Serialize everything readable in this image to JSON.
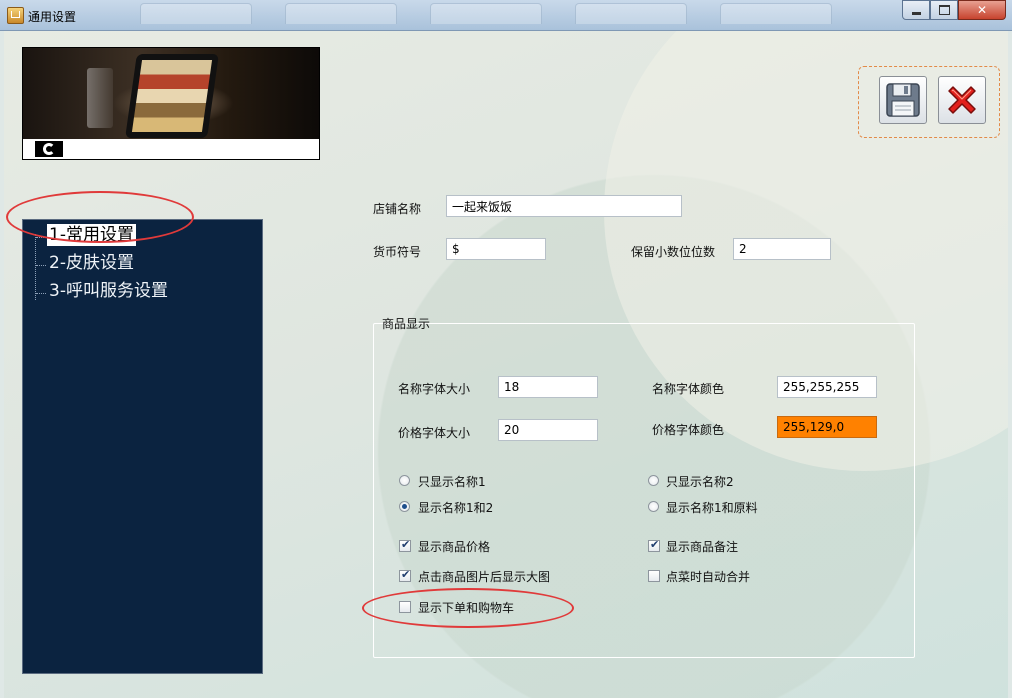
{
  "window": {
    "title": "通用设置",
    "close_glyph": "✕"
  },
  "nav": {
    "items": [
      {
        "label": "1-常用设置",
        "selected": true
      },
      {
        "label": "2-皮肤设置",
        "selected": false
      },
      {
        "label": "3-呼叫服务设置",
        "selected": false
      }
    ]
  },
  "toolbar": {
    "save_icon": "floppy-disk-icon",
    "close_icon": "red-x-icon"
  },
  "form": {
    "store_name_label": "店铺名称",
    "store_name_value": "一起来饭饭",
    "currency_label": "货币符号",
    "currency_value": "$",
    "decimals_label": "保留小数位位数",
    "decimals_value": "2"
  },
  "product_display": {
    "title": "商品显示",
    "name_font_size_label": "名称字体大小",
    "name_font_size_value": "18",
    "name_font_color_label": "名称字体颜色",
    "name_font_color_value": "255,255,255",
    "price_font_size_label": "价格字体大小",
    "price_font_size_value": "20",
    "price_font_color_label": "价格字体颜色",
    "price_font_color_value": "255,129,0",
    "price_font_color_swatch": "#ff8100",
    "radios": [
      {
        "label": "只显示名称1",
        "checked": false
      },
      {
        "label": "只显示名称2",
        "checked": false
      },
      {
        "label": "显示名称1和2",
        "checked": true
      },
      {
        "label": "显示名称1和原料",
        "checked": false
      }
    ],
    "checkboxes": [
      {
        "label": "显示商品价格",
        "checked": true
      },
      {
        "label": "显示商品备注",
        "checked": true
      },
      {
        "label": "点击商品图片后显示大图",
        "checked": true
      },
      {
        "label": "点菜时自动合并",
        "checked": false
      },
      {
        "label": "显示下单和购物车",
        "checked": false
      }
    ]
  },
  "colors": {
    "nav_background": "#0b2340",
    "annotation": "#e03a3a",
    "toolbar_border": "#e28a48"
  }
}
